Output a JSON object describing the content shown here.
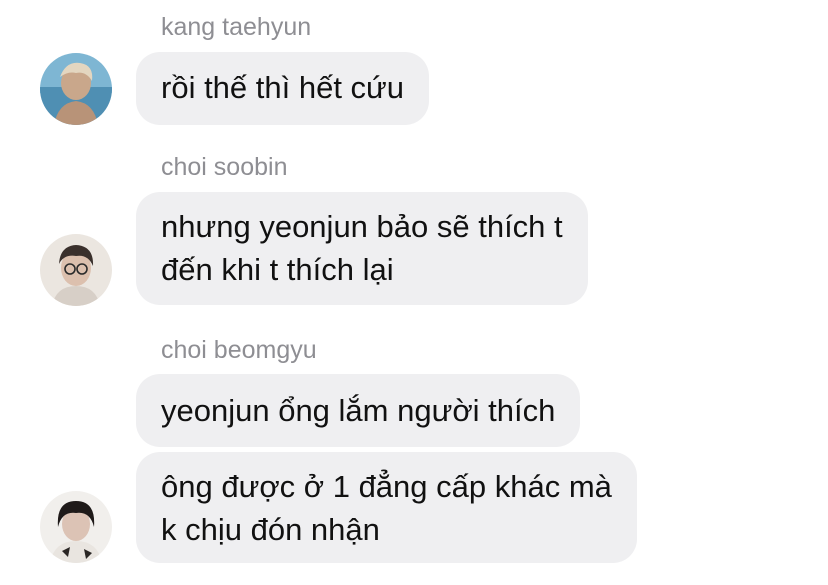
{
  "messages": [
    {
      "sender": "kang taehyun",
      "lines": [
        "rồi thế thì hết cứu"
      ]
    },
    {
      "sender": "choi soobin",
      "lines": [
        "nhưng yeonjun bảo sẽ thích t",
        "đến khi t thích lại"
      ]
    },
    {
      "sender": "choi beomgyu",
      "lines": [
        "yeonjun ổng lắm người thích"
      ]
    },
    {
      "sender": "",
      "lines": [
        "ông được ở 1 đẳng cấp khác mà",
        "k chịu đón nhận"
      ]
    }
  ],
  "avatars": [
    {
      "icon": "taehyun-avatar-photo",
      "colors": [
        "#6aa9c9",
        "#c6a88c",
        "#e8dcc8"
      ]
    },
    {
      "icon": "soobin-avatar-photo",
      "colors": [
        "#e9e3dc",
        "#3a302c",
        "#d6b8a6"
      ]
    },
    {
      "icon": "beomgyu-avatar-photo",
      "colors": [
        "#f1efec",
        "#1f1a19",
        "#d9bfb0"
      ]
    }
  ],
  "colors": {
    "bubble": "#efeff1",
    "sender_name": "#8e8e93",
    "text": "#111111",
    "background": "#ffffff"
  }
}
